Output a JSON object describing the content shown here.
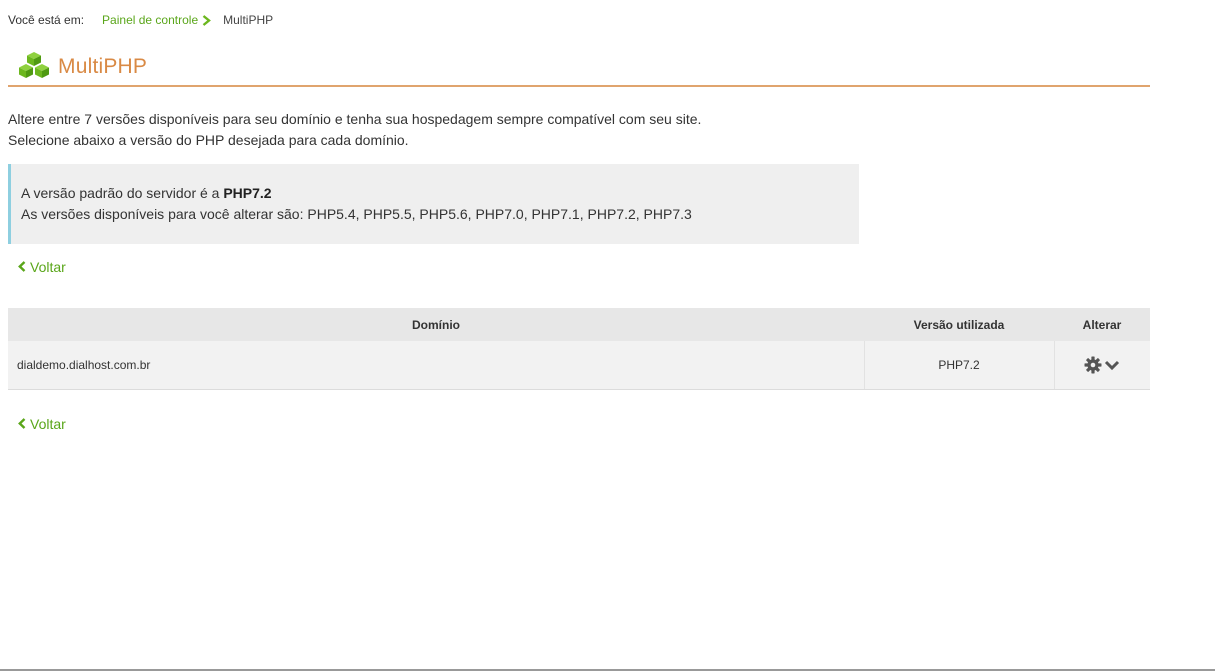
{
  "breadcrumb": {
    "prefix": "Você está em:",
    "items": [
      "Painel de controle",
      "MultiPHP"
    ]
  },
  "header": {
    "title": "MultiPHP",
    "icon": "cubes-icon"
  },
  "intro": {
    "line1": "Altere entre 7 versões disponíveis para seu domínio e tenha sua hospedagem sempre compatível com seu site.",
    "line2": "Selecione abaixo a versão do PHP desejada para cada domínio."
  },
  "info": {
    "default_prefix": "A versão padrão do servidor é a ",
    "default_version": "PHP7.2",
    "available_line": "As versões disponíveis para você alterar são: PHP5.4, PHP5.5, PHP5.6, PHP7.0, PHP7.1, PHP7.2, PHP7.3"
  },
  "nav": {
    "back_label": "Voltar"
  },
  "table": {
    "headers": [
      "Domínio",
      "Versão utilizada",
      "Alterar"
    ],
    "rows": [
      {
        "domain": "dialdemo.dialhost.com.br",
        "version": "PHP7.2"
      }
    ]
  },
  "colors": {
    "accent_green": "#5aa61a",
    "title_orange": "#d98a45",
    "rule_orange": "#e0a46e",
    "info_border": "#8ecfe0"
  }
}
